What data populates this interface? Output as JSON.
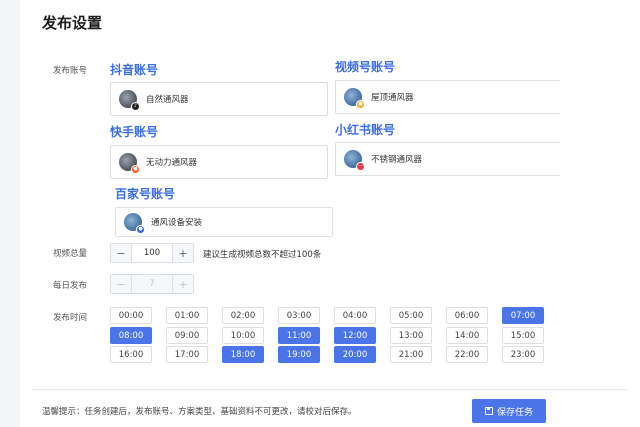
{
  "page": {
    "title": "发布设置"
  },
  "labels": {
    "accounts": "发布账号",
    "total_videos": "视频总量",
    "daily_publish": "每日发布",
    "publish_time": "发布时间"
  },
  "platforms": [
    {
      "name": "抖音账号",
      "account": "自然通风器",
      "badge_color": "#222222",
      "badge_glyph": "♪"
    },
    {
      "name": "视频号账号",
      "account": "屋顶通风器",
      "badge_color": "#f5a623",
      "badge_glyph": "●"
    },
    {
      "name": "快手账号",
      "account": "无动力通风器",
      "badge_color": "#ff5a1f",
      "badge_glyph": "●"
    },
    {
      "name": "小红书账号",
      "account": "不锈钢通风器",
      "badge_color": "#e8334a",
      "badge_glyph": "—"
    },
    {
      "name": "百家号账号",
      "account": "通风设备安装",
      "badge_color": "#2f5fe0",
      "badge_glyph": "●"
    }
  ],
  "total_videos": {
    "minus": "−",
    "value": "100",
    "plus": "+",
    "hint": "建议生成视频总数不超过100条"
  },
  "daily_publish": {
    "minus": "−",
    "value": "7",
    "plus": "+"
  },
  "time_slots": [
    {
      "label": "00:00",
      "selected": false
    },
    {
      "label": "01:00",
      "selected": false
    },
    {
      "label": "02:00",
      "selected": false
    },
    {
      "label": "03:00",
      "selected": false
    },
    {
      "label": "04:00",
      "selected": false
    },
    {
      "label": "05:00",
      "selected": false
    },
    {
      "label": "06:00",
      "selected": false
    },
    {
      "label": "07:00",
      "selected": true
    },
    {
      "label": "08:00",
      "selected": true
    },
    {
      "label": "09:00",
      "selected": false
    },
    {
      "label": "10:00",
      "selected": false
    },
    {
      "label": "11:00",
      "selected": true
    },
    {
      "label": "12:00",
      "selected": true
    },
    {
      "label": "13:00",
      "selected": false
    },
    {
      "label": "14:00",
      "selected": false
    },
    {
      "label": "15:00",
      "selected": false
    },
    {
      "label": "16:00",
      "selected": false
    },
    {
      "label": "17:00",
      "selected": false
    },
    {
      "label": "18:00",
      "selected": true
    },
    {
      "label": "19:00",
      "selected": true
    },
    {
      "label": "20:00",
      "selected": true
    },
    {
      "label": "21:00",
      "selected": false
    },
    {
      "label": "22:00",
      "selected": false
    },
    {
      "label": "23:00",
      "selected": false
    }
  ],
  "footer": {
    "tip": "温馨提示：任务创建后，发布账号、方案类型、基础资料不可更改，请校对后保存。",
    "save_label": "保存任务"
  }
}
